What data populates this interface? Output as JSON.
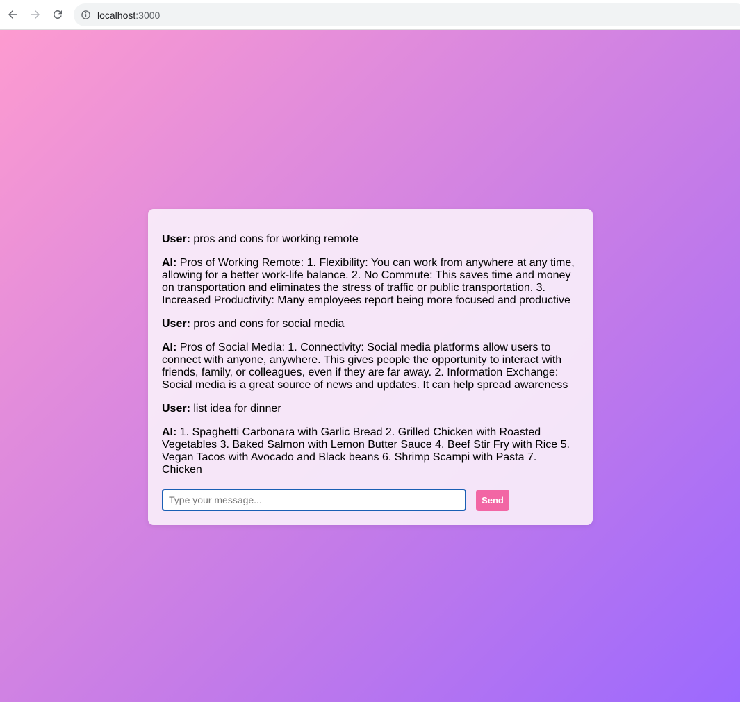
{
  "browser": {
    "url_host": "localhost",
    "url_port": ":3000"
  },
  "chat": {
    "messages": [
      {
        "speaker": "User:",
        "text": " pros and cons for working remote"
      },
      {
        "speaker": "AI:",
        "text": " Pros of Working Remote: 1. Flexibility: You can work from anywhere at any time, allowing for a better work-life balance. 2. No Commute: This saves time and money on transportation and eliminates the stress of traffic or public transportation. 3. Increased Productivity: Many employees report being more focused and productive"
      },
      {
        "speaker": "User:",
        "text": " pros and cons for social media"
      },
      {
        "speaker": "AI:",
        "text": " Pros of Social Media: 1. Connectivity: Social media platforms allow users to connect with anyone, anywhere. This gives people the opportunity to interact with friends, family, or colleagues, even if they are far away. 2. Information Exchange: Social media is a great source of news and updates. It can help spread awareness"
      },
      {
        "speaker": "User:",
        "text": " list idea for dinner"
      },
      {
        "speaker": "AI:",
        "text": " 1. Spaghetti Carbonara with Garlic Bread 2. Grilled Chicken with Roasted Vegetables 3. Baked Salmon with Lemon Butter Sauce 4. Beef Stir Fry with Rice 5. Vegan Tacos with Avocado and Black beans 6. Shrimp Scampi with Pasta 7. Chicken"
      }
    ],
    "input_placeholder": "Type your message...",
    "input_value": "",
    "send_label": "Send"
  },
  "colors": {
    "send_button": "#f266a4",
    "input_border": "#1a5fb4",
    "gradient_start": "#fd9bd0",
    "gradient_end": "#9c69fe"
  },
  "icons": {
    "back": "arrow-left-icon",
    "forward": "arrow-right-icon",
    "reload": "reload-icon",
    "site_info": "info-icon"
  }
}
